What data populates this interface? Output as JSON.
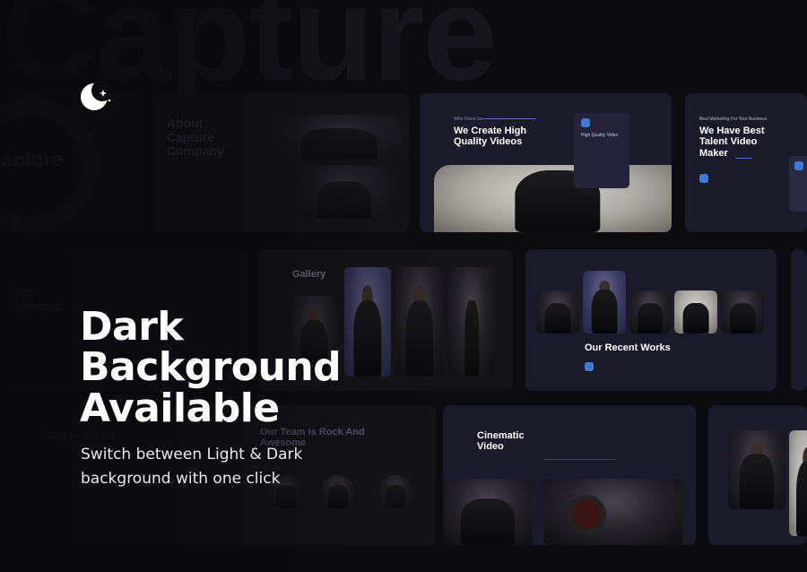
{
  "background_word": "Capture",
  "logo": {
    "icon": "moon-star-icon"
  },
  "headline": {
    "line1": "Dark",
    "line2": "Background",
    "line3": "Available"
  },
  "subheadline": {
    "line1": "Switch between Light & Dark",
    "line2": "background with one click"
  },
  "slides": {
    "about": {
      "title": "About Capture Company"
    },
    "video": {
      "eyebrow": "Who Owns Us",
      "title": "We Create High Quality Videos",
      "card_title": "High Quality Video"
    },
    "talent": {
      "eyebrow": "Best Marketing For Your Business",
      "title": "We Have Best Talent Video Maker"
    },
    "services": {
      "title": "Our Services"
    },
    "gallery": {
      "title": "Gallery"
    },
    "works": {
      "title": "Our Recent Works"
    },
    "contact": {
      "title": "Get In Touch"
    },
    "team": {
      "title": "Our Team Is Rock And Awesome"
    },
    "cinematic": {
      "title": "Cinematic Video"
    },
    "capture_logo": {
      "text": "apture"
    }
  },
  "colors": {
    "accent": "#3f7ad8",
    "slide_bg": "#1b1a2a",
    "page_bg": "#0c0c10"
  }
}
